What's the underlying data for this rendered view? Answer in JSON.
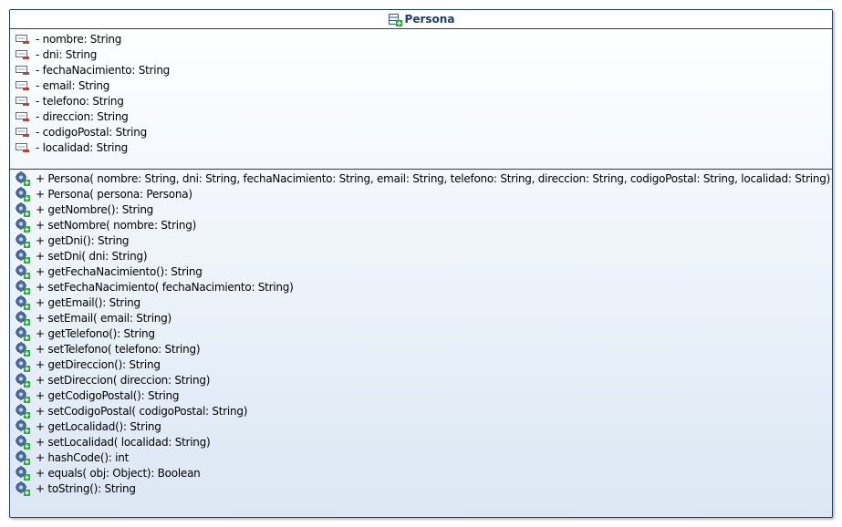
{
  "class_name": "Persona",
  "icons": {
    "class": "class-icon",
    "attribute": "private-field-icon",
    "operation": "public-method-icon"
  },
  "colors": {
    "border": "#1f3f6b",
    "title": "#1e3c72",
    "gradient_bottom": "#dbe7f4"
  },
  "attributes": [
    "- nombre: String",
    "- dni: String",
    "- fechaNacimiento: String",
    "- email: String",
    "- telefono: String",
    "- direccion: String",
    "- codigoPostal: String",
    "- localidad: String"
  ],
  "operations": [
    "+ Persona(  nombre: String,   dni: String,   fechaNacimiento: String,   email: String,   telefono: String,   direccion: String,   codigoPostal: String,   localidad: String)",
    "+ Persona(  persona: Persona)",
    "+ getNombre(): String",
    "+ setNombre(  nombre: String)",
    "+ getDni(): String",
    "+ setDni(  dni: String)",
    "+ getFechaNacimiento(): String",
    "+ setFechaNacimiento(  fechaNacimiento: String)",
    "+ getEmail(): String",
    "+ setEmail(  email: String)",
    "+ getTelefono(): String",
    "+ setTelefono(  telefono: String)",
    "+ getDireccion(): String",
    "+ setDireccion(  direccion: String)",
    "+ getCodigoPostal(): String",
    "+ setCodigoPostal(  codigoPostal: String)",
    "+ getLocalidad(): String",
    "+ setLocalidad(  localidad: String)",
    "+ hashCode(): int",
    "+ equals(  obj: Object): Boolean",
    "+ toString(): String"
  ]
}
